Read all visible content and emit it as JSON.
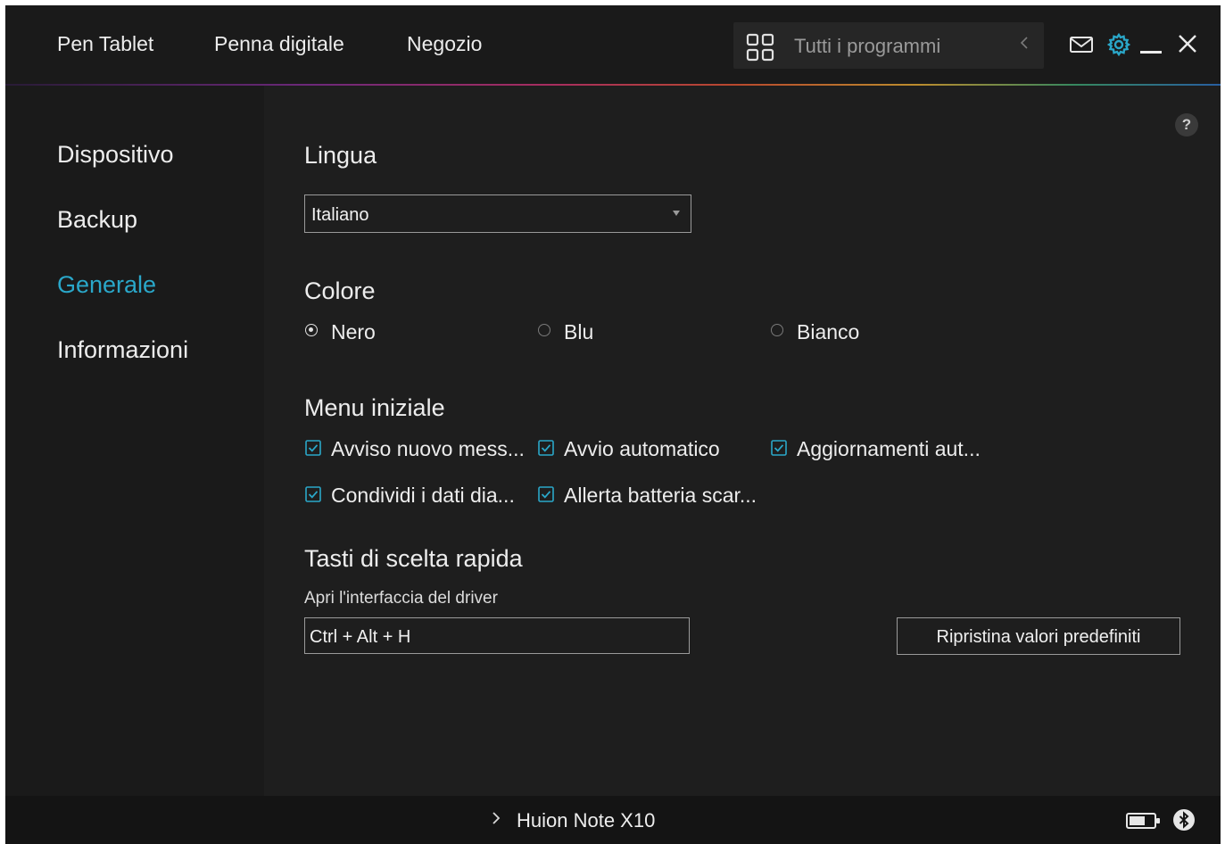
{
  "topbar": {
    "nav": [
      "Pen Tablet",
      "Penna digitale",
      "Negozio"
    ],
    "program_selector": {
      "icon": "apps-grid-icon",
      "label": "Tutti i programmi",
      "chevron_icon": "chevron-left-icon"
    },
    "window_icons": [
      "mail-icon",
      "gear-icon",
      "minimize-icon",
      "close-icon"
    ]
  },
  "sidebar": {
    "items": [
      "Dispositivo",
      "Backup",
      "Generale",
      "Informazioni"
    ],
    "active_item": "Generale"
  },
  "main": {
    "help_label": "?",
    "language": {
      "title": "Lingua",
      "selected": "Italiano"
    },
    "color": {
      "title": "Colore",
      "options": [
        "Nero",
        "Blu",
        "Bianco"
      ],
      "selected": "Nero"
    },
    "start_menu": {
      "title": "Menu iniziale",
      "options": [
        {
          "label": "Avviso nuovo mess...",
          "checked": true
        },
        {
          "label": "Avvio automatico",
          "checked": true
        },
        {
          "label": "Aggiornamenti aut...",
          "checked": true
        },
        {
          "label": "Condividi i dati dia...",
          "checked": true
        },
        {
          "label": "Allerta batteria scar...",
          "checked": true
        }
      ]
    },
    "hotkeys": {
      "title": "Tasti di scelta rapida",
      "open_driver_label": "Apri l'interfaccia del driver",
      "open_driver_value": "Ctrl + Alt + H",
      "reset_button": "Ripristina valori predefiniti"
    }
  },
  "statusbar": {
    "chevron": "›",
    "device_name": "Huion Note X10",
    "icons": [
      "battery-icon",
      "bluetooth-icon"
    ]
  },
  "colors": {
    "background": "#1e1e1e",
    "topbar": "#1a1a1a",
    "accent": "#2aa7c9",
    "gear_icon": "#2aa7c9"
  }
}
